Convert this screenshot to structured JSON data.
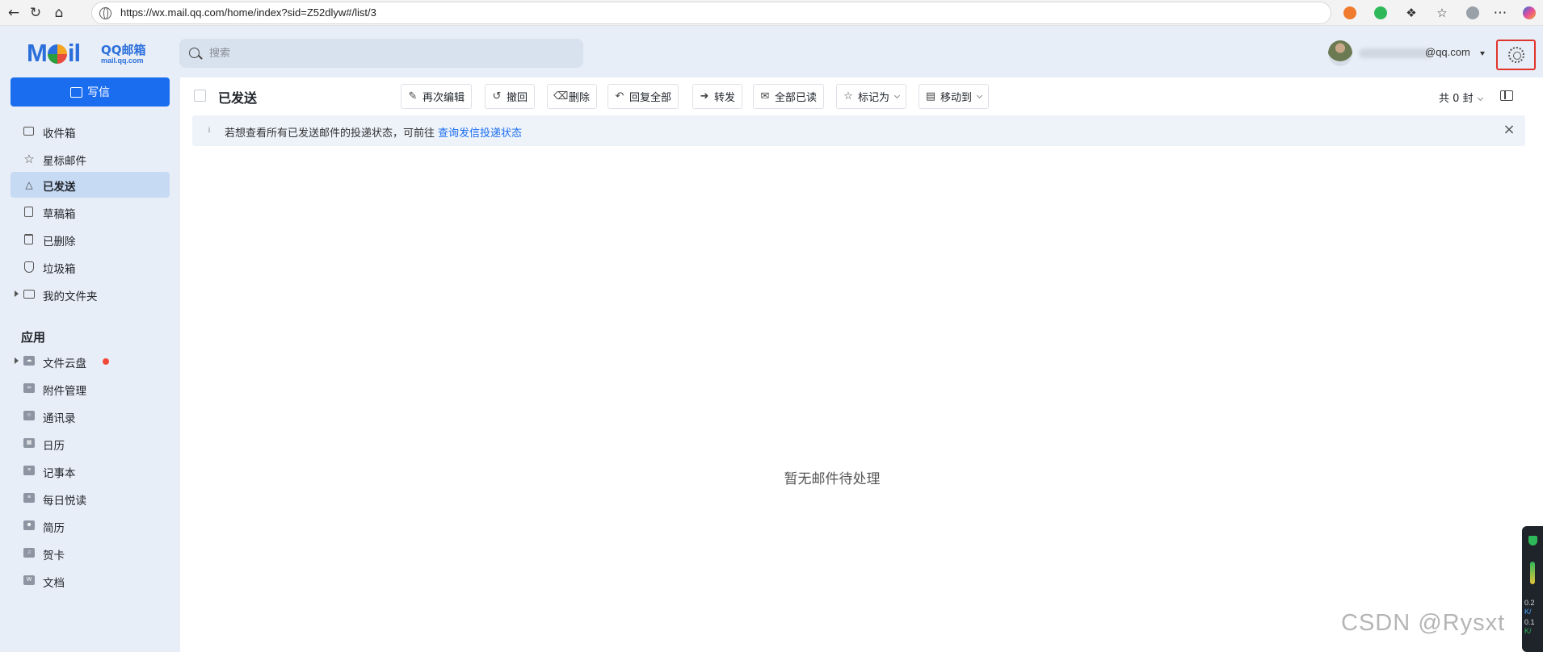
{
  "browser": {
    "url": "https://wx.mail.qq.com/home/index?sid=Z52dlyw#/list/3"
  },
  "logo": {
    "word": "M",
    "word2": "il",
    "brand": "QQ邮箱",
    "domain": "mail.qq.com"
  },
  "search": {
    "placeholder": "搜索"
  },
  "user": {
    "email_suffix": "@qq.com"
  },
  "sidebar": {
    "compose_label": "写信",
    "folders": [
      {
        "label": "收件箱",
        "icon": "inbox-icon"
      },
      {
        "label": "星标邮件",
        "icon": "star-icon"
      },
      {
        "label": "已发送",
        "icon": "sent-icon",
        "active": true
      },
      {
        "label": "草稿箱",
        "icon": "draft-icon"
      },
      {
        "label": "已删除",
        "icon": "trash-icon"
      },
      {
        "label": "垃圾箱",
        "icon": "spam-shield-icon"
      },
      {
        "label": "我的文件夹",
        "icon": "folder-icon"
      }
    ],
    "apps_title": "应用",
    "apps": [
      {
        "label": "文件云盘",
        "icon": "cloud-drive-icon",
        "badge": true
      },
      {
        "label": "附件管理",
        "icon": "attachment-icon"
      },
      {
        "label": "通讯录",
        "icon": "contacts-icon"
      },
      {
        "label": "日历",
        "icon": "calendar-icon"
      },
      {
        "label": "记事本",
        "icon": "notepad-icon"
      },
      {
        "label": "每日悦读",
        "icon": "reading-icon"
      },
      {
        "label": "简历",
        "icon": "resume-icon"
      },
      {
        "label": "贺卡",
        "icon": "greeting-card-icon"
      },
      {
        "label": "文档",
        "icon": "document-icon"
      }
    ]
  },
  "toolbar": {
    "folder_title": "已发送",
    "buttons": [
      {
        "label": "再次编辑",
        "icon": "edit-icon"
      },
      {
        "label": "撤回",
        "icon": "recall-icon"
      },
      {
        "label": "删除",
        "icon": "delete-icon"
      },
      {
        "label": "回复全部",
        "icon": "reply-all-icon"
      },
      {
        "label": "转发",
        "icon": "forward-icon"
      },
      {
        "label": "全部已读",
        "icon": "mark-all-read-icon"
      },
      {
        "label": "标记为",
        "icon": "star-icon"
      },
      {
        "label": "移动到",
        "icon": "move-folder-icon"
      }
    ],
    "count_label": "共 0 封"
  },
  "notice": {
    "text": "若想查看所有已发送邮件的投递状态，可前往",
    "link": "查询发信投递状态"
  },
  "empty_state": "暂无邮件待处理",
  "watermark": "CSDN @Rysxt",
  "side_widget": {
    "line1": "0.2",
    "line2": "K/",
    "line3": "0.1",
    "line4": "K/"
  },
  "colors": {
    "accent": "#1b6df0",
    "active_bg": "#c7daf3",
    "page_bg": "#e8eef7",
    "highlight_border": "#e0352b"
  }
}
